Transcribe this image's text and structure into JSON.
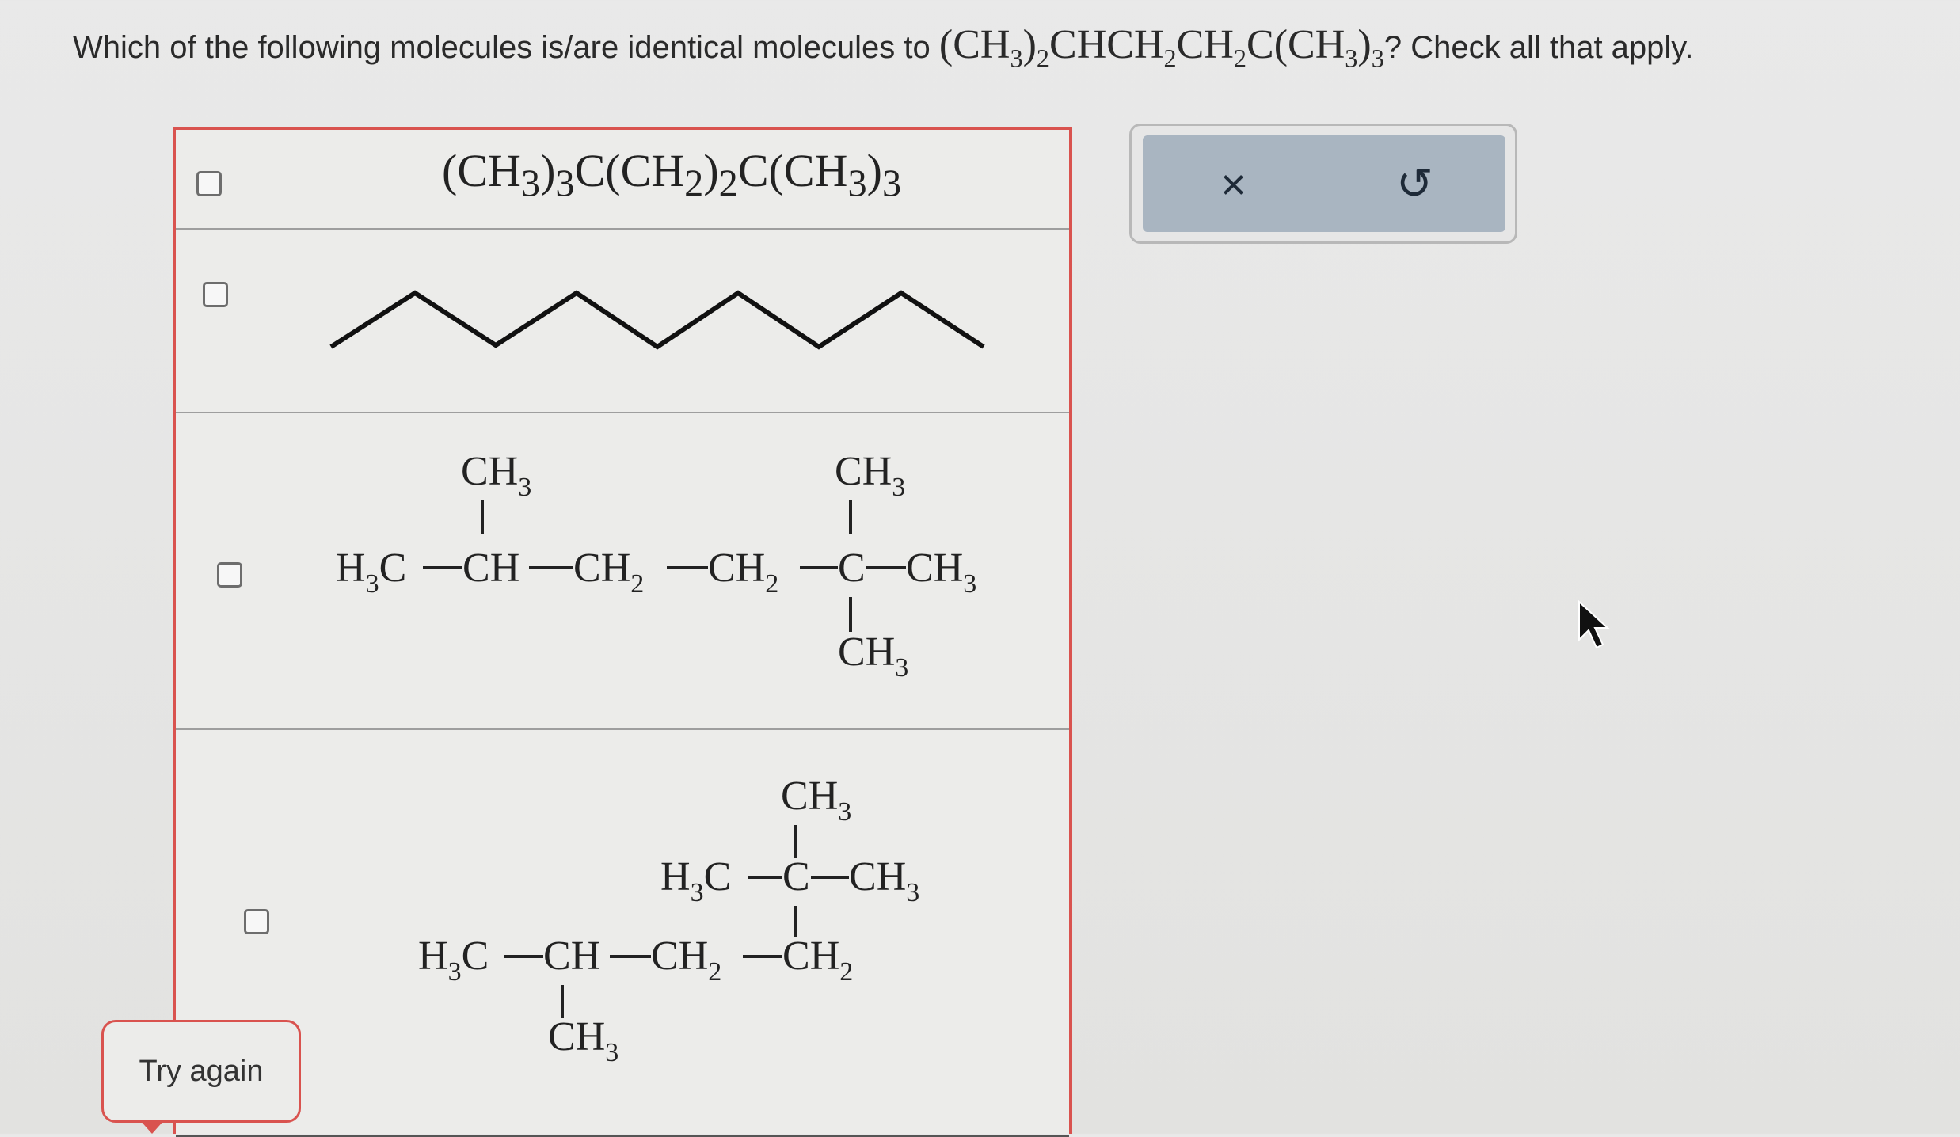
{
  "question": {
    "prefix": "Which of the following molecules is/are identical molecules to",
    "formula": "(CH3)2CHCH2CH2C(CH3)3",
    "suffix": "? Check all that apply."
  },
  "options": [
    {
      "id": "option-1",
      "kind": "condensed-formula",
      "text": "(CH3)3C(CH2)2C(CH3)3",
      "checked": false
    },
    {
      "id": "option-2",
      "kind": "skeletal-zigzag",
      "checked": false
    },
    {
      "id": "option-3",
      "kind": "expanded-structure",
      "labels": {
        "top_methyl_1": "CH3",
        "top_methyl_2": "CH3",
        "left_end": "H3C",
        "ch": "CH",
        "ch2_a": "CH2",
        "ch2_b": "CH2",
        "quat_c": "C",
        "right_end": "CH3",
        "bottom_methyl": "CH3"
      },
      "checked": false
    },
    {
      "id": "option-4",
      "kind": "expanded-structure",
      "labels": {
        "top_methyl": "CH3",
        "h3c_upper": "H3C",
        "quat_c": "C",
        "ch3_right": "CH3",
        "h3c_lower": "H3C",
        "ch": "CH",
        "ch2_a": "CH2",
        "ch2_b": "CH2",
        "bottom_methyl": "CH3"
      },
      "checked": false
    }
  ],
  "toolbar": {
    "clear_icon": "×",
    "reset_icon": "↺"
  },
  "feedback": {
    "try_again_label": "Try again"
  },
  "colors": {
    "error_border": "#d9534f",
    "toolbar_fill": "#a9b5c1"
  }
}
